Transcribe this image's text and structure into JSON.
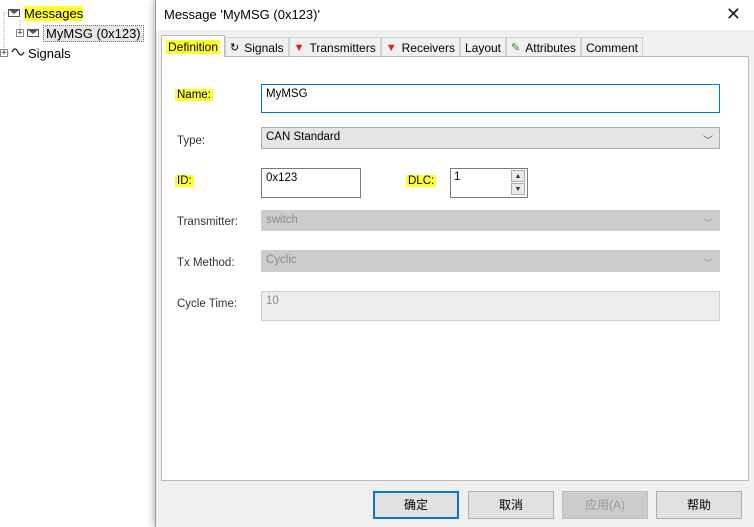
{
  "tree": {
    "messages_label": "Messages",
    "msg_item_label": "MyMSG (0x123)",
    "signals_label": "Signals"
  },
  "dialog": {
    "title": "Message 'MyMSG (0x123)'",
    "close_glyph": "✕",
    "tabs": [
      "Definition",
      "Signals",
      "Transmitters",
      "Receivers",
      "Layout",
      "Attributes",
      "Comment"
    ],
    "tab_icons": {
      "signals": "↻",
      "transmitters": "▼",
      "receivers": "▼",
      "attributes": "✎"
    },
    "form": {
      "name_label": "Name:",
      "name_value": "MyMSG",
      "type_label": "Type:",
      "type_value": "CAN Standard",
      "id_label": "ID:",
      "id_value": "0x123",
      "dlc_label": "DLC:",
      "dlc_value": "1",
      "transmitter_label": "Transmitter:",
      "transmitter_value": "switch",
      "txmethod_label": "Tx Method:",
      "txmethod_value": "Cyclic",
      "cycletime_label": "Cycle Time:",
      "cycletime_value": "10"
    },
    "buttons": {
      "ok": "确定",
      "cancel": "取消",
      "apply": "应用(A)",
      "help": "帮助"
    }
  },
  "colors": {
    "highlight": "#ffff2e",
    "focus_border": "#0078d7",
    "dialog_bg": "#f0f0f0"
  }
}
